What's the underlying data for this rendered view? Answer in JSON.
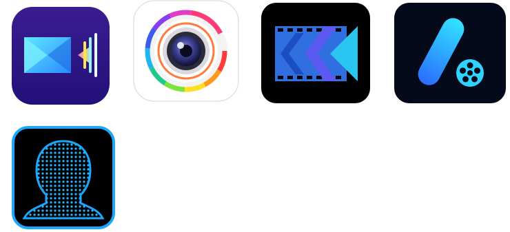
{
  "apps": [
    {
      "key": "icon-powerdirector-green",
      "icon": "video-editor-purple-icon",
      "colors": {
        "bg_top": "#3a1d8f",
        "bg_bottom": "#23107a",
        "accent": "#3fd0ff",
        "glow": "#ffe25a"
      }
    },
    {
      "key": "icon-photodirector",
      "icon": "rainbow-camera-lens-icon",
      "colors": {
        "bg": "#ffffff",
        "lens": "#3b3f8f"
      }
    },
    {
      "key": "icon-powerdirector",
      "icon": "film-strip-rewind-icon",
      "colors": {
        "bg": "#000000",
        "film": "#2f6fe0",
        "arrow1": "#5a5af0",
        "arrow2": "#29c6f2"
      }
    },
    {
      "key": "icon-promeo",
      "icon": "pill-and-film-reel-icon",
      "colors": {
        "bg": "#050a1a",
        "pill_top": "#32e3ff",
        "pill_bottom": "#2a6cff",
        "reel": "#2fd3ff"
      }
    },
    {
      "key": "icon-facedetect",
      "icon": "face-scan-head-icon",
      "colors": {
        "bg": "#000000",
        "border": "#1aa8ff",
        "dots": "#27b6ff"
      }
    }
  ]
}
